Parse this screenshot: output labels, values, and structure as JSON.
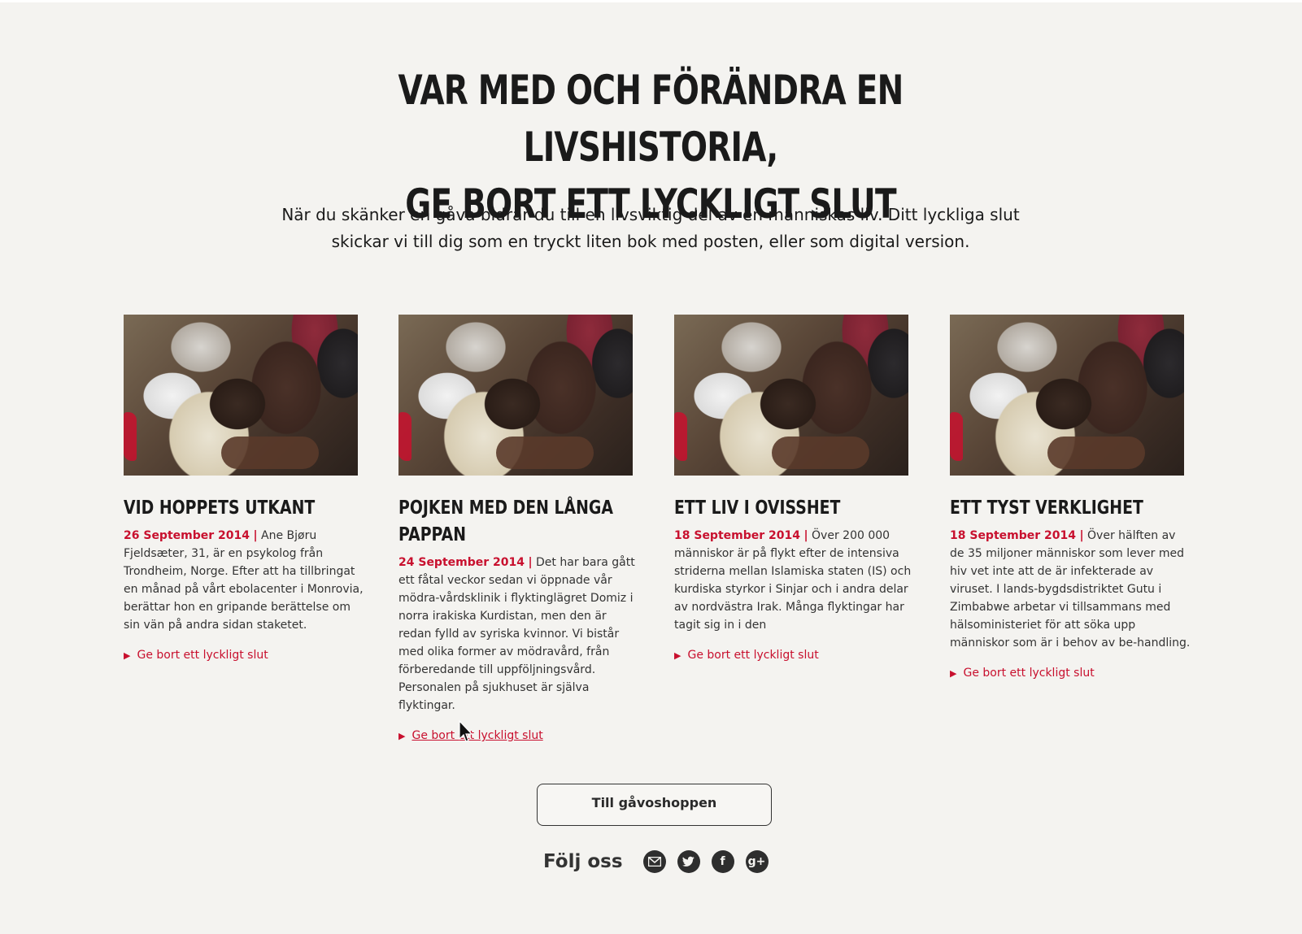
{
  "headline": {
    "line1": "Var med och förändra en livshistoria,",
    "line2": "ge bort ett lyckligt slut"
  },
  "intro": "När du skänker en gåva bidrar du till en livsviktig del av en människas liv. Ditt lyckliga slut skickar vi till dig som en tryckt liten bok med posten, eller som digital version.",
  "cards": [
    {
      "title": "Vid hoppets utkant",
      "date": "26 September 2014",
      "sep": "|",
      "text": "Ane Bjøru Fjeldsæter, 31, är en psykolog från Trondheim, Norge. Efter att ha tillbringat en månad på vårt ebolacenter i Monrovia, berättar hon en gripande berättelse om sin vän på andra sidan staketet.",
      "link": "Ge bort ett lyckligt slut"
    },
    {
      "title": "Pojken med den långa pappan",
      "date": "24 September 2014",
      "sep": "|",
      "text": "Det har bara gått ett fåtal veckor sedan vi öppnade vår mödra-vårdsklinik i flyktinglägret Domiz i norra irakiska Kurdistan, men den är redan fylld av syriska kvinnor. Vi bistår med olika former av mödravård, från förberedande till uppföljningsvård. Personalen på sjukhuset är själva flyktingar.",
      "link": "Ge bort ett lyckligt slut"
    },
    {
      "title": "Ett liv i ovisshet",
      "date": "18 September 2014",
      "sep": "|",
      "text": "Över 200 000 människor är på flykt efter de intensiva striderna mellan Islamiska staten (IS) och kurdiska styrkor i Sinjar och i andra delar av nordvästra Irak. Många flyktingar har tagit sig in i den",
      "link": "Ge bort ett lyckligt slut"
    },
    {
      "title": "Ett tyst verklighet",
      "date": "18 September 2014",
      "sep": "|",
      "text": "Över hälften av de 35 miljoner människor som lever med hiv vet inte att de är infekterade av viruset. I lands-bygdsdistriktet Gutu i Zimbabwe arbetar vi tillsammans med hälsoministeriet för att söka upp människor som är i behov av be-handling.",
      "link": "Ge bort ett lyckligt slut"
    }
  ],
  "shop_button": "Till gåvoshoppen",
  "follow": {
    "label": "Följ oss",
    "icons": [
      "mail-icon",
      "twitter-icon",
      "facebook-icon",
      "google-plus-icon"
    ]
  },
  "colors": {
    "accent": "#c8102e",
    "background": "#f4f3f0",
    "text": "#1a1a1a"
  }
}
